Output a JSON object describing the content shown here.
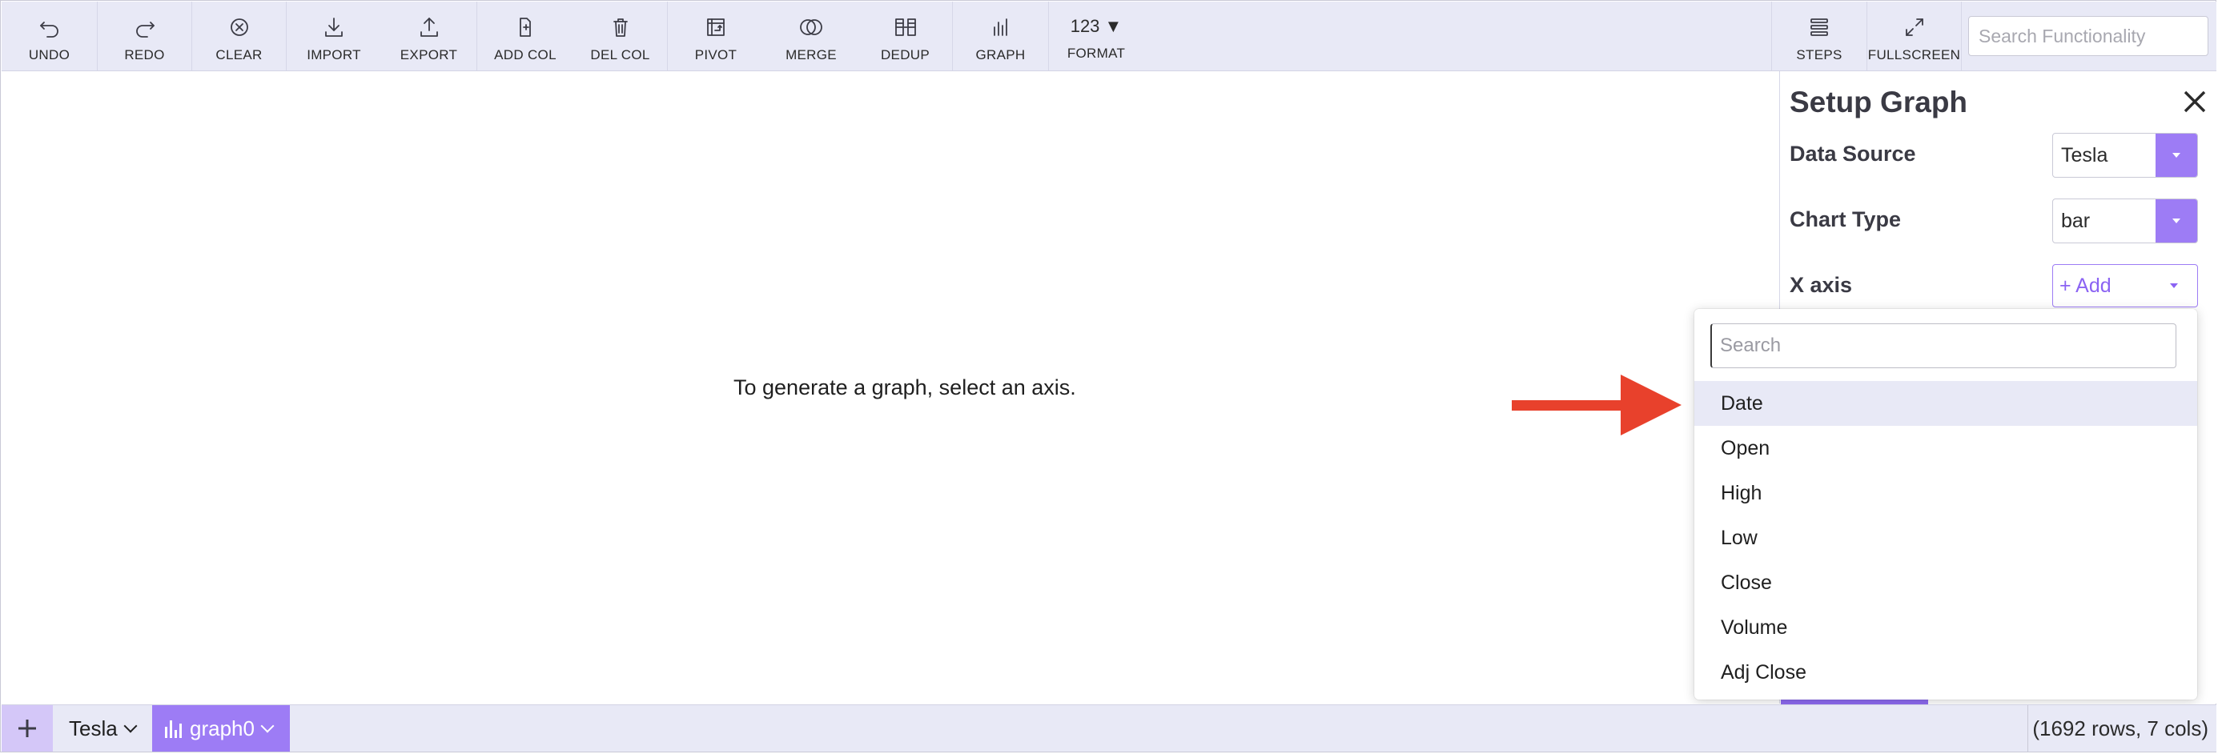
{
  "toolbar": {
    "undo": "UNDO",
    "redo": "REDO",
    "clear": "CLEAR",
    "import": "IMPORT",
    "export": "EXPORT",
    "add_col": "ADD COL",
    "del_col": "DEL COL",
    "pivot": "PIVOT",
    "merge": "MERGE",
    "dedup": "DEDUP",
    "graph": "GRAPH",
    "format": "FORMAT",
    "format_glyph": "123 ▼",
    "steps": "STEPS",
    "fullscreen": "FULLSCREEN",
    "search_placeholder": "Search Functionality"
  },
  "main": {
    "empty_message": "To generate a graph, select an axis."
  },
  "panel": {
    "title": "Setup Graph",
    "data_source_label": "Data Source",
    "data_source_value": "Tesla",
    "chart_type_label": "Chart Type",
    "chart_type_value": "bar",
    "x_axis_label": "X axis",
    "x_axis_add": "+ Add"
  },
  "dropdown": {
    "search_placeholder": "Search",
    "items": [
      "Date",
      "Open",
      "High",
      "Low",
      "Close",
      "Volume",
      "Adj Close"
    ],
    "highlighted": "Date"
  },
  "bottom": {
    "sheet_tab": "Tesla",
    "graph_tab": "graph0",
    "rows_info": "(1692 rows, 7 cols)"
  },
  "colors": {
    "accent": "#9d7cf5",
    "toolbar_bg": "#e8e9f6",
    "arrow": "#e8412c"
  }
}
